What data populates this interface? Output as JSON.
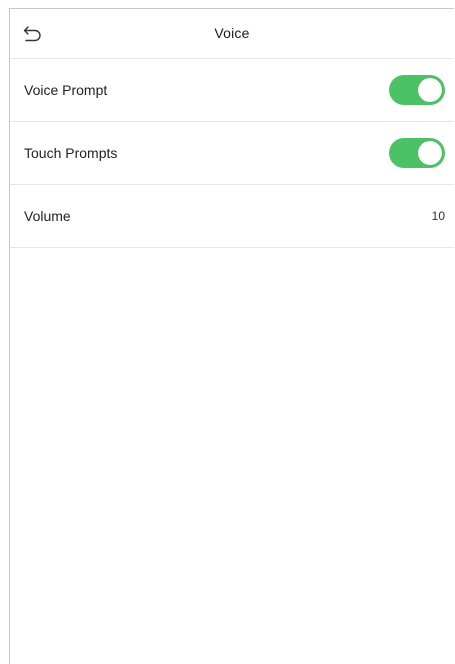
{
  "header": {
    "title": "Voice",
    "back_icon": "back-arrow-icon"
  },
  "settings": [
    {
      "label": "Voice Prompt",
      "type": "toggle",
      "enabled": true
    },
    {
      "label": "Touch Prompts",
      "type": "toggle",
      "enabled": true
    },
    {
      "label": "Volume",
      "type": "value",
      "value": "10"
    }
  ],
  "colors": {
    "toggle_on": "#4cc267",
    "divider": "#e6e6e6",
    "frame_border": "#c8c8c8"
  }
}
